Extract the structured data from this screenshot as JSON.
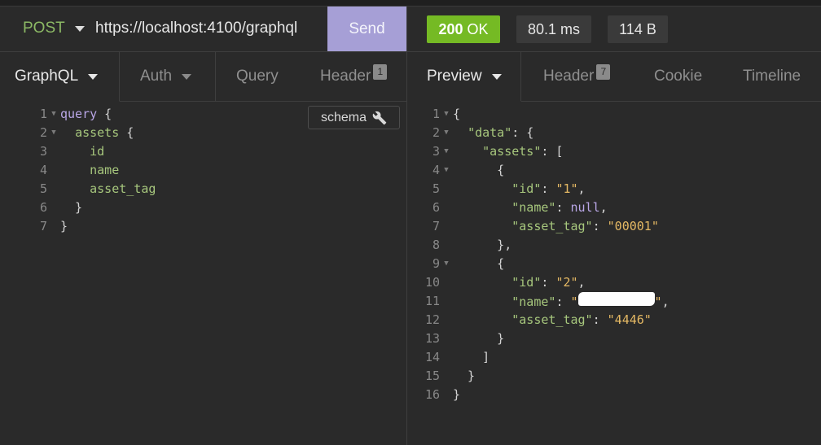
{
  "request": {
    "method": "POST",
    "url": "https://localhost:4100/graphql",
    "send_label": "Send"
  },
  "response_status": {
    "code": "200",
    "text": "OK",
    "time": "80.1 ms",
    "size": "114 B"
  },
  "request_tabs": [
    {
      "label": "GraphQL",
      "has_dropdown": true,
      "active": true
    },
    {
      "label": "Auth",
      "has_dropdown": true
    },
    {
      "label": "Query"
    },
    {
      "label": "Header",
      "count": "1"
    }
  ],
  "response_tabs": [
    {
      "label": "Preview",
      "has_dropdown": true,
      "active": true
    },
    {
      "label": "Header",
      "count": "7"
    },
    {
      "label": "Cookie"
    },
    {
      "label": "Timeline"
    }
  ],
  "schema_button_label": "schema",
  "query_editor": {
    "lines": [
      {
        "n": "1",
        "fold": true,
        "text": "query {"
      },
      {
        "n": "2",
        "fold": true,
        "text": "  assets {"
      },
      {
        "n": "3",
        "text": "    id"
      },
      {
        "n": "4",
        "text": "    name"
      },
      {
        "n": "5",
        "text": "    asset_tag"
      },
      {
        "n": "6",
        "text": "  }"
      },
      {
        "n": "7",
        "text": "}"
      }
    ]
  },
  "response_body": {
    "lines": [
      {
        "n": "1",
        "fold": true,
        "text": "{"
      },
      {
        "n": "2",
        "fold": true,
        "text": "  \"data\": {"
      },
      {
        "n": "3",
        "fold": true,
        "text": "    \"assets\": ["
      },
      {
        "n": "4",
        "fold": true,
        "text": "      {"
      },
      {
        "n": "5",
        "text": "        \"id\": \"1\","
      },
      {
        "n": "6",
        "text": "        \"name\": null,"
      },
      {
        "n": "7",
        "text": "        \"asset_tag\": \"00001\""
      },
      {
        "n": "8",
        "text": "      },"
      },
      {
        "n": "9",
        "fold": true,
        "text": "      {"
      },
      {
        "n": "10",
        "text": "        \"id\": \"2\","
      },
      {
        "n": "11",
        "text": "        \"name\": \"\",",
        "redacted": true
      },
      {
        "n": "12",
        "text": "        \"asset_tag\": \"4446\""
      },
      {
        "n": "13",
        "text": "      }"
      },
      {
        "n": "14",
        "text": "    ]"
      },
      {
        "n": "15",
        "text": "  }"
      },
      {
        "n": "16",
        "text": "}"
      }
    ]
  }
}
